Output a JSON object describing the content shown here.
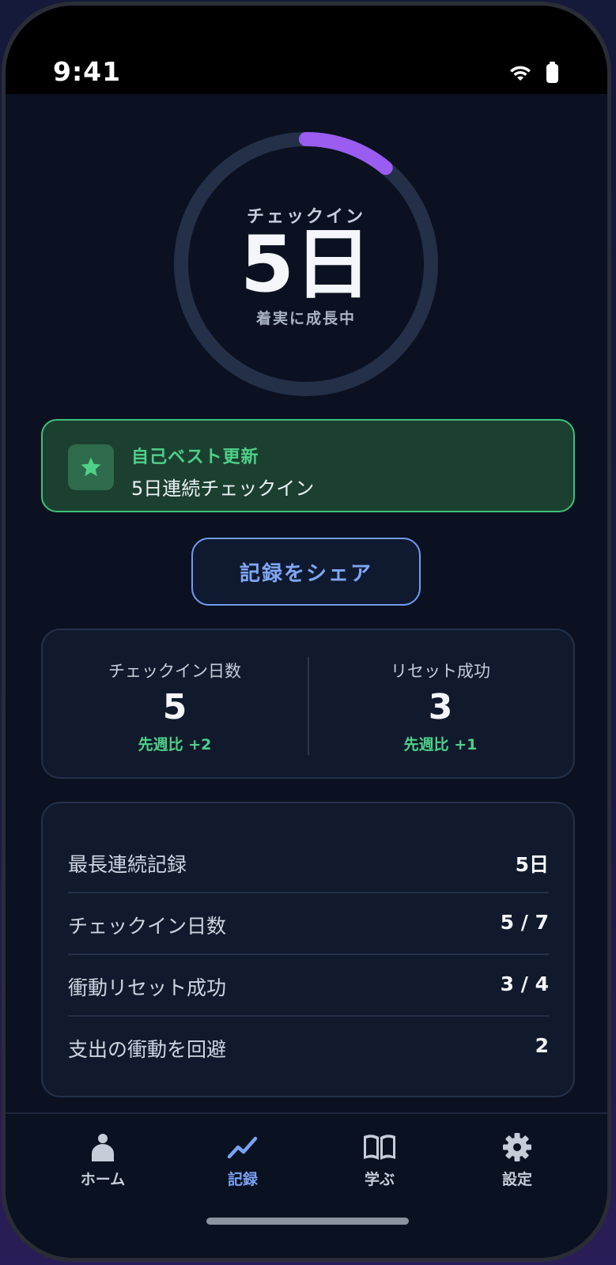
{
  "status_bar": {
    "time": "9:41",
    "icons": [
      "wifi-icon",
      "battery-icon"
    ]
  },
  "progress_ring": {
    "label": "チェックイン",
    "value": "5日",
    "subtitle": "着実に成長中",
    "progress_fraction": 0.11,
    "track_color": "#243048",
    "progress_color": "#9b5cf0"
  },
  "best_card": {
    "icon": "star-icon",
    "title": "自己ベスト更新",
    "description": "5日連続チェックイン",
    "accent_color": "#4ed088"
  },
  "share_button": {
    "label": "記録をシェア"
  },
  "stats": [
    {
      "label": "チェックイン日数",
      "value": "5",
      "delta": "先週比 +2"
    },
    {
      "label": "リセット成功",
      "value": "3",
      "delta": "先週比 +1"
    }
  ],
  "details": [
    {
      "label": "最長連続記録",
      "value": "5日"
    },
    {
      "label": "チェックイン日数",
      "value": "5 / 7"
    },
    {
      "label": "衝動リセット成功",
      "value": "3 / 4"
    },
    {
      "label": "支出の衝動を回避",
      "value": "2"
    }
  ],
  "bottom_nav": {
    "items": [
      {
        "label": "ホーム",
        "icon": "person-icon",
        "active": false
      },
      {
        "label": "記録",
        "icon": "trend-chart-icon",
        "active": true
      },
      {
        "label": "学ぶ",
        "icon": "book-icon",
        "active": false
      },
      {
        "label": "設定",
        "icon": "gear-icon",
        "active": false
      }
    ]
  }
}
